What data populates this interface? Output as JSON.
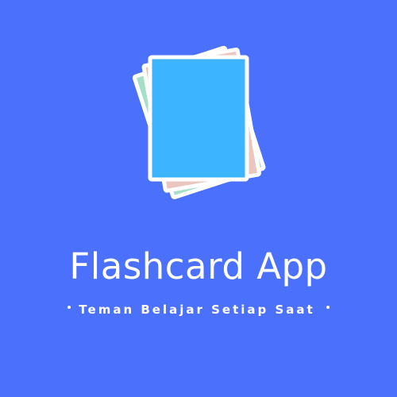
{
  "app": {
    "title": "Flashcard App",
    "tagline": "Teman Belajar Setiap Saat"
  },
  "logo": {
    "icon": "flashcard-stack-icon",
    "colors": {
      "front_card": "#3cb4ff",
      "middle_card": "#e9c7bf",
      "back_card": "#a6dfc9",
      "border": "#ffffff"
    }
  },
  "colors": {
    "background": "#4b70fb",
    "text": "#ffffff"
  }
}
